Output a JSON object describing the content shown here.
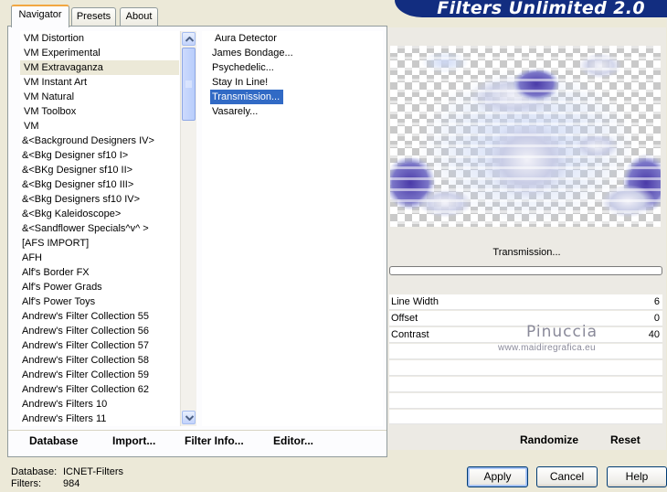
{
  "tabs": [
    {
      "label": "Navigator",
      "active": true
    },
    {
      "label": "Presets",
      "active": false
    },
    {
      "label": "About",
      "active": false
    }
  ],
  "banner": {
    "title": "Filters Unlimited 2.0"
  },
  "categories": {
    "items": [
      "VM Distortion",
      "VM Experimental",
      "VM Extravaganza",
      "VM Instant Art",
      "VM Natural",
      "VM Toolbox",
      "VM",
      "&<Background Designers IV>",
      "&<Bkg Designer sf10 I>",
      "&<BKg Designer sf10 II>",
      "&<Bkg Designer sf10 III>",
      "&<Bkg Designers sf10 IV>",
      "&<Bkg Kaleidoscope>",
      "&<Sandflower Specials^v^ >",
      "[AFS IMPORT]",
      "AFH",
      "Alf's Border FX",
      "Alf's Power Grads",
      "Alf's Power Toys",
      "Andrew's Filter Collection 55",
      "Andrew's Filter Collection 56",
      "Andrew's Filter Collection 57",
      "Andrew's Filter Collection 58",
      "Andrew's Filter Collection 59",
      "Andrew's Filter Collection 62",
      "Andrew's Filters 10",
      "Andrew's Filters 11"
    ],
    "selected_index": 2
  },
  "filters": {
    "items": [
      "Aura Detector",
      "James Bondage...",
      "Psychedelic...",
      "Stay In Line!",
      "Transmission...",
      "Vasarely..."
    ],
    "selected_index": 4
  },
  "filter_name": "Transmission...",
  "params": [
    {
      "label": "Line Width",
      "value": "6"
    },
    {
      "label": "Offset",
      "value": "0"
    },
    {
      "label": "Contrast",
      "value": "40"
    }
  ],
  "watermark": {
    "name": "Pinuccia",
    "url": "www.maidiregrafica.eu"
  },
  "left_buttons": [
    {
      "label": "Database"
    },
    {
      "label": "Import..."
    },
    {
      "label": "Filter Info..."
    },
    {
      "label": "Editor..."
    }
  ],
  "right_buttons": {
    "randomize": "Randomize",
    "reset": "Reset"
  },
  "status": {
    "database_label": "Database:",
    "database_value": "ICNET-Filters",
    "filters_label": "Filters:",
    "filters_value": "984"
  },
  "dialog_buttons": {
    "apply": "Apply",
    "cancel": "Cancel",
    "help": "Help"
  },
  "colors": {
    "selection": "#316ac5",
    "banner": "#122d80",
    "tab_accent": "#f2a742"
  }
}
